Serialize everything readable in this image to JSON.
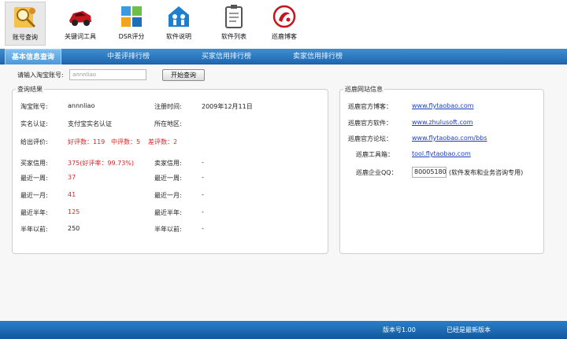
{
  "toolbar": {
    "items": [
      {
        "label": "账号查询",
        "icon": "magnifier-person-icon"
      },
      {
        "label": "关键词工具",
        "icon": "sports-car-icon"
      },
      {
        "label": "DSR评分",
        "icon": "windows-grid-icon"
      },
      {
        "label": "软件说明",
        "icon": "people-house-icon"
      },
      {
        "label": "软件列表",
        "icon": "clipboard-icon"
      },
      {
        "label": "巡鹿博客",
        "icon": "red-seal-icon"
      }
    ]
  },
  "tabs": [
    "基本信息查询",
    "中差评排行榜",
    "买家信用排行榜",
    "卖家信用排行榜"
  ],
  "search": {
    "label": "请输入淘宝账号:",
    "value": "annnliao",
    "button": "开始查询"
  },
  "result": {
    "title": "查询结果",
    "account_label": "淘宝账号:",
    "account_value": "annnliao",
    "register_label": "注册时间:",
    "register_value": "2009年12月11日",
    "realname_label": "实名认证:",
    "realname_value": "支付宝实名认证",
    "region_label": "所在地区:",
    "region_value": "",
    "review_label": "给出评价:",
    "good_review": "好评数：119",
    "mid_review": "中评数：5",
    "bad_review": "差评数：2",
    "buyer_credit_label": "买家信用:",
    "buyer_credit_value": "375(好评率：99.73%)",
    "seller_credit_label": "卖家信用:",
    "seller_credit_value": "-",
    "week_label": "最近一周:",
    "week_value": "37",
    "month_label": "最近一月:",
    "month_value": "41",
    "halfyear_label": "最近半年:",
    "halfyear_value": "125",
    "before_label": "半年以前:",
    "before_value": "250",
    "seller_week_label": "最近一周:",
    "seller_week_value": "-",
    "seller_month_label": "最近一月:",
    "seller_month_value": "-",
    "seller_halfyear_label": "最近半年:",
    "seller_halfyear_value": "-",
    "seller_before_label": "半年以前:",
    "seller_before_value": "-"
  },
  "site": {
    "title": "巡鹿网站信息",
    "blog_label": "巡鹿官方博客：",
    "blog_url": "www.flytaobao.com",
    "software_label": "巡鹿官方软件：",
    "software_url": "www.zhulusoft.com",
    "forum_label": "巡鹿官方论坛：",
    "forum_url": "www.flytaobao.com/bbs",
    "tools_label": "巡鹿工具箱：",
    "tools_url": "tool.flytaobao.com",
    "qq_label": "巡鹿企业QQ：",
    "qq_value": "80005180",
    "qq_note": "(软件发布和业务咨询专用)"
  },
  "status": {
    "version": "版本号1.00",
    "update": "已经是最新版本"
  },
  "colors": {
    "tab_blue": "#1f67b0",
    "red_value": "#e02424",
    "link_blue": "#1a3fc4"
  }
}
